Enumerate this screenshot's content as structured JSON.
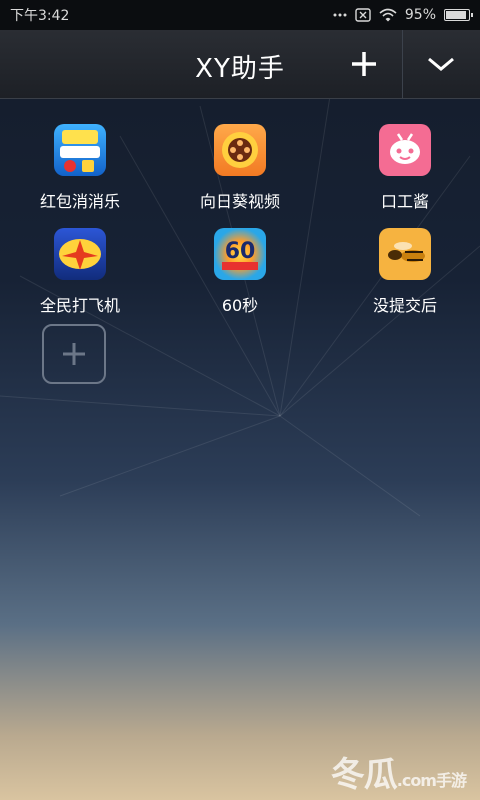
{
  "status_bar": {
    "time": "下午3:42",
    "battery": "95%",
    "battery_level": 0.95,
    "icons": [
      "more-dots-icon",
      "sim-x-icon",
      "wifi-icon",
      "battery-icon"
    ]
  },
  "header": {
    "title": "XY助手",
    "add_icon": "plus-icon",
    "menu_icon": "chevron-down-icon"
  },
  "apps": [
    {
      "label": "红包消消乐",
      "icon": "hongbao-xiaoxiaole-icon",
      "color": "#1d7bd8"
    },
    {
      "label": "向日葵视频",
      "icon": "sunflower-video-icon",
      "color": "#f07b2a"
    },
    {
      "label": "口工酱",
      "icon": "robot-face-icon",
      "color": "#f26b92"
    },
    {
      "label": "全民打飞机",
      "icon": "plane-game-icon",
      "color": "#1f3fa8"
    },
    {
      "label": "60秒",
      "icon": "sixty-seconds-icon",
      "color": "#2aa7e8"
    },
    {
      "label": "没提交后",
      "icon": "wasp-icon",
      "color": "#f6b340"
    }
  ],
  "add_slot_icon": "plus-icon",
  "watermark": {
    "text": "冬瓜",
    "suffix": "手游",
    "domain": ".com"
  }
}
